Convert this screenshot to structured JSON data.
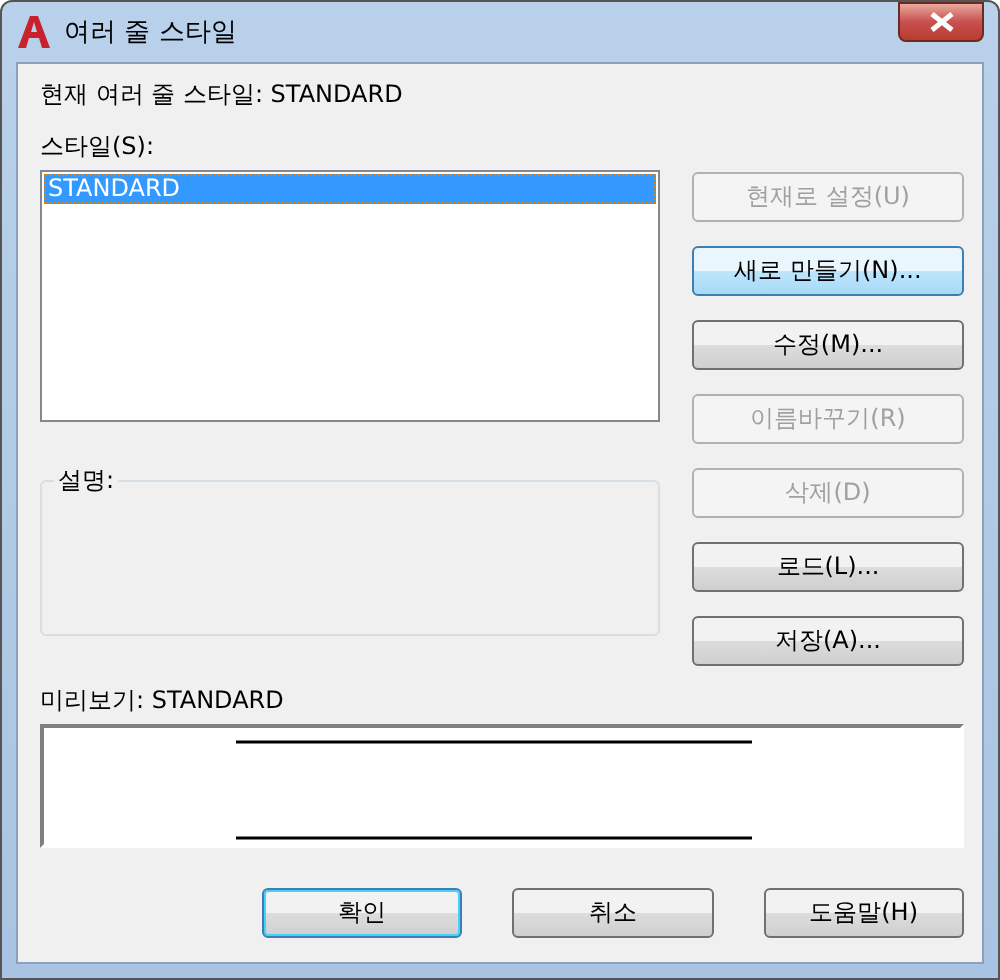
{
  "window": {
    "title": "여러 줄 스타일"
  },
  "current_style": "현재 여러 줄 스타일: STANDARD",
  "styles": {
    "label": "스타일(S):",
    "items": [
      {
        "label": "STANDARD",
        "selected": true
      }
    ]
  },
  "side_buttons": [
    {
      "label": "현재로 설정(U)",
      "disabled": true,
      "hover": false
    },
    {
      "label": "새로 만들기(N)...",
      "disabled": false,
      "hover": true
    },
    {
      "label": "수정(M)...",
      "disabled": false,
      "hover": false
    },
    {
      "label": "이름바꾸기(R)",
      "disabled": true,
      "hover": false
    },
    {
      "label": "삭제(D)",
      "disabled": true,
      "hover": false
    },
    {
      "label": "로드(L)...",
      "disabled": false,
      "hover": false
    },
    {
      "label": "저장(A)...",
      "disabled": false,
      "hover": false
    }
  ],
  "description": {
    "label": "설명:"
  },
  "preview": {
    "label": "미리보기: STANDARD"
  },
  "buttons": [
    {
      "label": "확인",
      "default": true
    },
    {
      "label": "취소",
      "default": false
    },
    {
      "label": "도움말(H)",
      "default": false
    }
  ]
}
